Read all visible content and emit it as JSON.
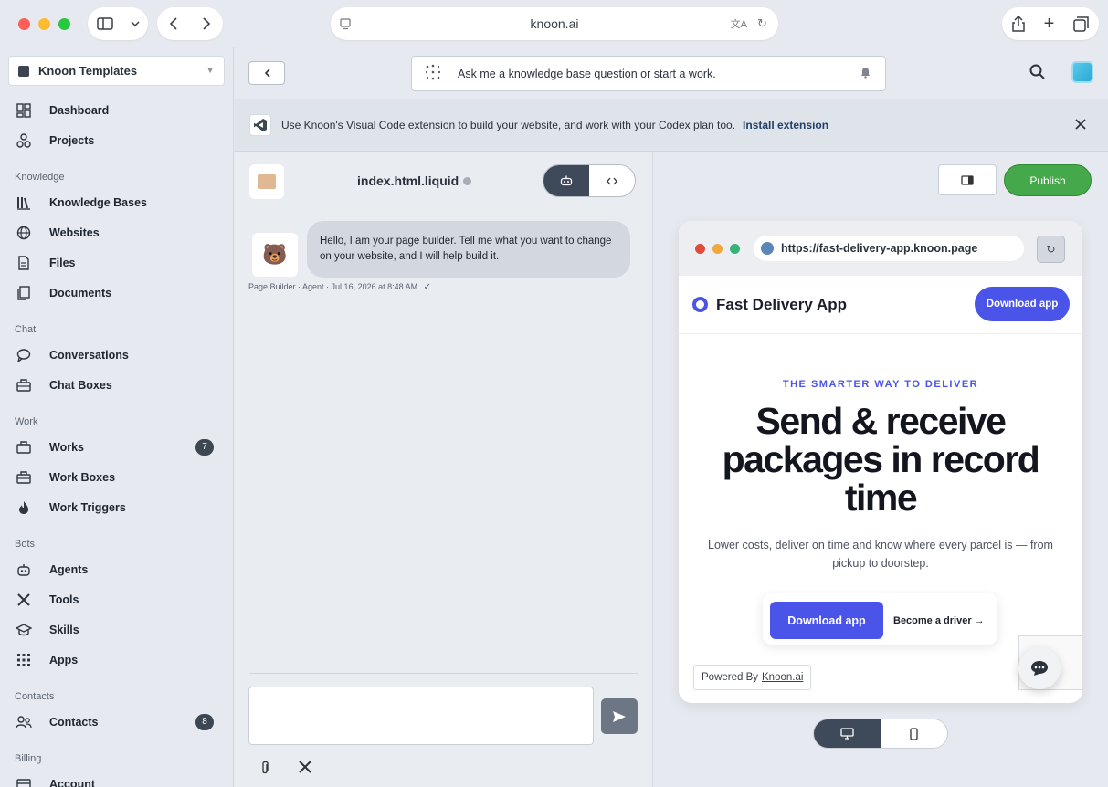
{
  "browser": {
    "url": "knoon.ai"
  },
  "sidebar": {
    "workspace": "Knoon Templates",
    "items_top": [
      {
        "label": "Dashboard",
        "icon": "dashboard-icon"
      },
      {
        "label": "Projects",
        "icon": "projects-icon"
      }
    ],
    "sections": [
      {
        "title": "Knowledge",
        "items": [
          {
            "label": "Knowledge Bases",
            "icon": "library-icon"
          },
          {
            "label": "Websites",
            "icon": "globe-icon"
          },
          {
            "label": "Files",
            "icon": "file-icon"
          },
          {
            "label": "Documents",
            "icon": "documents-icon"
          }
        ]
      },
      {
        "title": "Chat",
        "items": [
          {
            "label": "Conversations",
            "icon": "chat-bubble-icon"
          },
          {
            "label": "Chat Boxes",
            "icon": "briefcase-icon"
          }
        ]
      },
      {
        "title": "Work",
        "items": [
          {
            "label": "Works",
            "icon": "work-icon",
            "badge": "7"
          },
          {
            "label": "Work Boxes",
            "icon": "toolbox-icon"
          },
          {
            "label": "Work Triggers",
            "icon": "flame-icon"
          }
        ]
      },
      {
        "title": "Bots",
        "items": [
          {
            "label": "Agents",
            "icon": "robot-icon"
          },
          {
            "label": "Tools",
            "icon": "tools-icon"
          },
          {
            "label": "Skills",
            "icon": "graduation-cap-icon"
          },
          {
            "label": "Apps",
            "icon": "grid-icon"
          }
        ]
      },
      {
        "title": "Contacts",
        "items": [
          {
            "label": "Contacts",
            "icon": "people-icon",
            "badge": "8"
          }
        ]
      },
      {
        "title": "Billing",
        "items": [
          {
            "label": "Account",
            "icon": "account-icon"
          }
        ]
      }
    ]
  },
  "header": {
    "ask_placeholder": "Ask me a knowledge base question or start a work."
  },
  "banner": {
    "text": "Use Knoon's Visual Code extension to build your website, and work with your Codex plan too.",
    "link": "Install extension"
  },
  "chat": {
    "file_name": "index.html.liquid",
    "message": "Hello, I am your page builder. Tell me what you want to change on your website, and I will help build it.",
    "meta": "Page Builder · Agent · Jul 16, 2026 at 8:48 AM"
  },
  "preview": {
    "publish_label": "Publish",
    "mock_url": "https://fast-delivery-app.knoon.page",
    "site_name": "Fast Delivery App",
    "nav_cta": "Download app",
    "eyebrow": "THE SMARTER WAY TO DELIVER",
    "hero_title": "Send & receive packages in record time",
    "hero_sub": "Lower costs, deliver on time and know where every parcel is — from pickup to doorstep.",
    "cta_primary": "Download app",
    "cta_secondary": "Become a driver →",
    "powered_prefix": "Powered By",
    "powered_link": "Knoon.ai"
  },
  "colors": {
    "accent": "#4b54e8",
    "publish": "#45a84a",
    "sidebar_bg": "#e6e9ef"
  }
}
